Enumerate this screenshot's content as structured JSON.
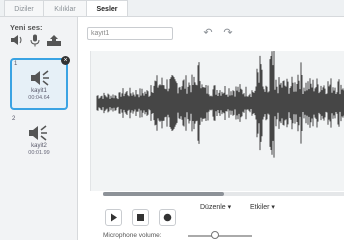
{
  "tabs": [
    {
      "label": "Diziler"
    },
    {
      "label": "Kılıklar"
    },
    {
      "label": "Sesler",
      "active": true
    }
  ],
  "new_sound": {
    "label": "Yeni ses:",
    "icons": [
      "speaker-library-icon",
      "microphone-icon",
      "upload-icon"
    ]
  },
  "sounds": [
    {
      "number": "1",
      "name": "kayit1",
      "duration": "00:04.64",
      "selected": true
    },
    {
      "number": "2",
      "name": "kayit2",
      "duration": "00:01.99",
      "selected": false
    }
  ],
  "editor": {
    "name_value": "kayit1",
    "edit_menu": "Düzenle ▾",
    "effects_menu": "Etkiler ▾",
    "microphone_label": "Microphone volume:",
    "microphone_volume": 0.42,
    "scroll_fraction": 0.5
  },
  "colors": {
    "selection": "#3aa3e3",
    "waveform": "#1a1a1a",
    "panel": "#f2f3f5"
  }
}
